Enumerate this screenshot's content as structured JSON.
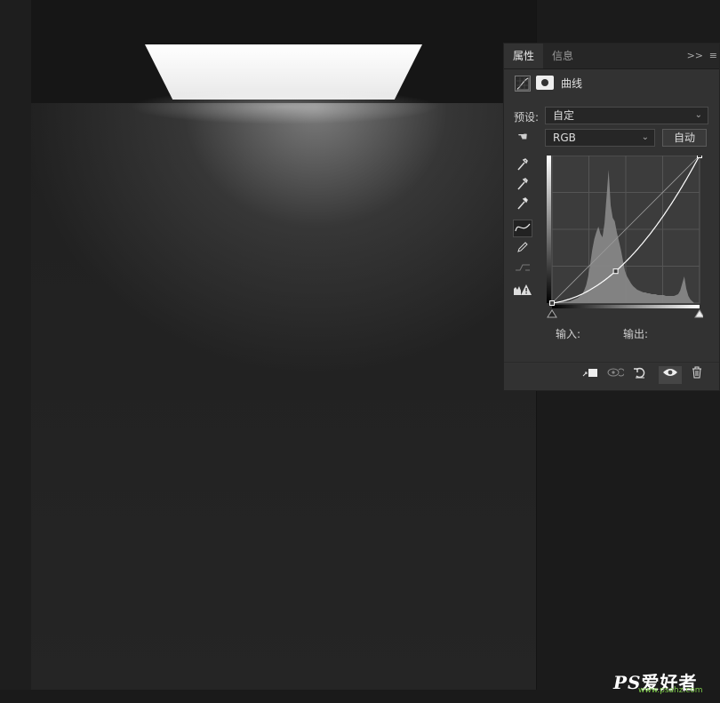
{
  "panel": {
    "tabs": [
      "属性",
      "信息"
    ],
    "collapse_icon": ">>",
    "menu_icon": "≡",
    "adjustment_title": "曲线",
    "preset_label": "预设:",
    "preset_value": "自定",
    "channel_value": "RGB",
    "auto_button": "自动",
    "input_label": "输入:",
    "output_label": "输出:",
    "tools": [
      "eyedropper-black-icon",
      "eyedropper-gray-icon",
      "eyedropper-white-icon",
      "curve-point-icon",
      "pencil-icon",
      "smooth-icon",
      "clipping-warning-icon"
    ],
    "footer_icons": [
      "clip-to-layer-icon",
      "view-previous-icon",
      "reset-icon",
      "visibility-icon",
      "trash-icon"
    ]
  },
  "watermark": {
    "brand": "PS",
    "text": "爱好者",
    "url": "www.psahz.com"
  },
  "chart_data": {
    "type": "line",
    "title": "",
    "series": [
      {
        "values": [
          [
            0,
            0
          ],
          [
            110,
            55
          ],
          [
            255,
            255
          ]
        ]
      }
    ],
    "xlim": [
      0,
      255
    ],
    "ylim": [
      0,
      255
    ],
    "grid": true
  }
}
